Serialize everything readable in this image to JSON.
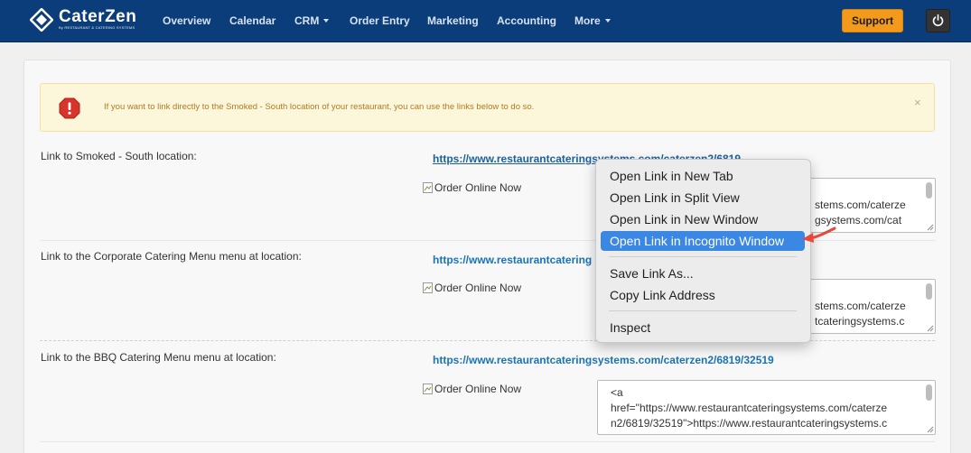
{
  "brand": {
    "name": "CaterZen",
    "tagline": "By RESTAURANT & CATERING SYSTEMS",
    "color": "#0b3d7a"
  },
  "nav": {
    "items": [
      {
        "label": "Overview",
        "dropdown": false
      },
      {
        "label": "Calendar",
        "dropdown": false
      },
      {
        "label": "CRM",
        "dropdown": true
      },
      {
        "label": "Order Entry",
        "dropdown": false
      },
      {
        "label": "Marketing",
        "dropdown": false
      },
      {
        "label": "Accounting",
        "dropdown": false
      },
      {
        "label": "More",
        "dropdown": true
      }
    ],
    "support_label": "Support",
    "support_color": "#f49a1b",
    "power_icon": "power-icon"
  },
  "alert": {
    "text": "If you want to link directly to the Smoked - South location of your restaurant, you can use the links below to do so.",
    "icon": "stop-warning-icon",
    "close": "×"
  },
  "rows": [
    {
      "label": "Link to Smoked - South location:",
      "link": "https://www.restaurantcateringsystems.com/caterzen2/6819",
      "image_alt": "Order Online Now",
      "code_lines": [
        "",
        "",
        "stems.com/caterze",
        "gsystems.com/cat"
      ]
    },
    {
      "label": "Link to the Corporate Catering Menu menu at location:",
      "link": "https://www.restaurantcatering",
      "image_alt": "Order Online Now",
      "code_lines": [
        "",
        "",
        "stems.com/caterze",
        "tcateringsystems.c"
      ]
    },
    {
      "label": "Link to the BBQ Catering Menu menu at location:",
      "link": "https://www.restaurantcateringsystems.com/caterzen2/6819/32519",
      "image_alt": "Order Online Now",
      "code_lines": [
        "<a",
        "href=\"https://www.restaurantcateringsystems.com/caterze",
        "n2/6819/32519\">https://www.restaurantcateringsystems.c"
      ]
    }
  ],
  "context_menu": {
    "items": [
      {
        "label": "Open Link in New Tab"
      },
      {
        "label": "Open Link in Split View"
      },
      {
        "label": "Open Link in New Window"
      },
      {
        "label": "Open Link in Incognito Window",
        "highlighted": true
      },
      {
        "label": "Save Link As..."
      },
      {
        "label": "Copy Link Address"
      },
      {
        "label": "Inspect"
      }
    ],
    "highlight_color": "#3b87e4",
    "annotation_arrow_color": "#e8473b"
  }
}
